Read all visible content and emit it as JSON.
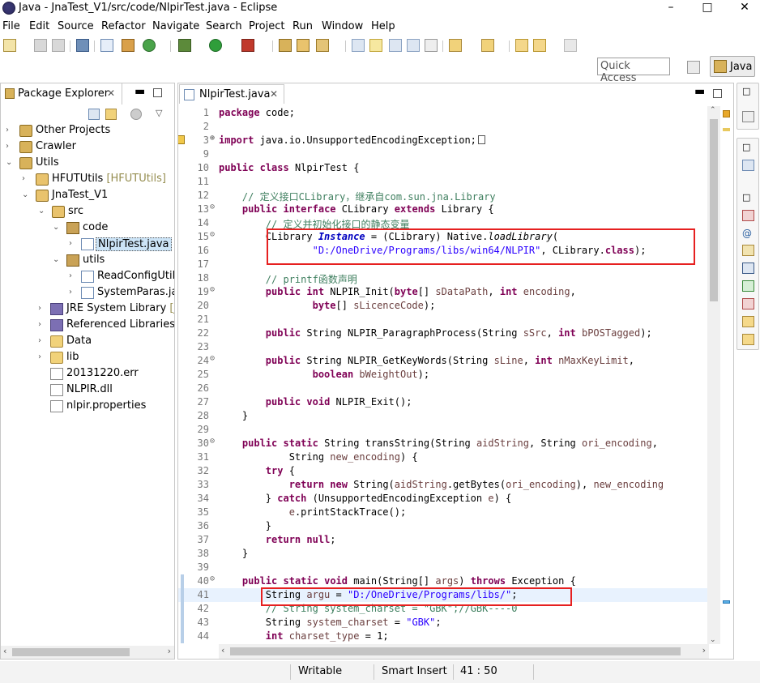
{
  "window": {
    "title": "Java - JnaTest_V1/src/code/NlpirTest.java - Eclipse"
  },
  "menu": [
    "File",
    "Edit",
    "Source",
    "Refactor",
    "Navigate",
    "Search",
    "Project",
    "Run",
    "Window",
    "Help"
  ],
  "quick_access": {
    "placeholder": "Quick Access"
  },
  "perspective": {
    "label": "Java"
  },
  "package_explorer": {
    "tab_label": "Package Explorer",
    "tree": [
      {
        "label": "Other Projects",
        "decoration": ""
      },
      {
        "label": "Crawler",
        "decoration": ""
      },
      {
        "label": "Utils",
        "decoration": ""
      },
      {
        "label": "HFUTUtils",
        "decoration": " [HFUTUtils]"
      },
      {
        "label": "JnaTest_V1",
        "decoration": ""
      },
      {
        "label": "src",
        "decoration": ""
      },
      {
        "label": "code",
        "decoration": ""
      },
      {
        "label": "NlpirTest.java",
        "decoration": ""
      },
      {
        "label": "utils",
        "decoration": ""
      },
      {
        "label": "ReadConfigUtil.j",
        "decoration": ""
      },
      {
        "label": "SystemParas.jav",
        "decoration": ""
      },
      {
        "label": "JRE System Library",
        "decoration": " [Ja"
      },
      {
        "label": "Referenced Libraries",
        "decoration": ""
      },
      {
        "label": "Data",
        "decoration": ""
      },
      {
        "label": "lib",
        "decoration": ""
      },
      {
        "label": "20131220.err",
        "decoration": ""
      },
      {
        "label": "NLPIR.dll",
        "decoration": ""
      },
      {
        "label": "nlpir.properties",
        "decoration": ""
      }
    ]
  },
  "editor": {
    "tab_label": "NlpirTest.java",
    "line_numbers": [
      "1",
      "2",
      "3",
      "9",
      "10",
      "11",
      "12",
      "13",
      "14",
      "15",
      "16",
      "17",
      "18",
      "19",
      "20",
      "21",
      "22",
      "23",
      "24",
      "25",
      "26",
      "27",
      "28",
      "29",
      "30",
      "31",
      "32",
      "33",
      "34",
      "35",
      "36",
      "37",
      "38",
      "39",
      "40",
      "41",
      "42",
      "43",
      "44"
    ],
    "lines": [
      "package code;",
      "",
      "import java.io.UnsupportedEncodingException;",
      "",
      "public class NlpirTest {",
      "",
      "    // 定义接口CLibrary，继承自com.sun.jna.Library",
      "    public interface CLibrary extends Library {",
      "        // 定义并初始化接口的静态变量",
      "        CLibrary Instance = (CLibrary) Native.loadLibrary(",
      "                \"D:/OneDrive/Programs/libs/win64/NLPIR\", CLibrary.class);",
      "",
      "        // printf函数声明",
      "        public int NLPIR_Init(byte[] sDataPath, int encoding,",
      "                byte[] sLicenceCode);",
      "",
      "        public String NLPIR_ParagraphProcess(String sSrc, int bPOSTagged);",
      "",
      "        public String NLPIR_GetKeyWords(String sLine, int nMaxKeyLimit,",
      "                boolean bWeightOut);",
      "",
      "        public void NLPIR_Exit();",
      "    }",
      "",
      "    public static String transString(String aidString, String ori_encoding,",
      "            String new_encoding) {",
      "        try {",
      "            return new String(aidString.getBytes(ori_encoding), new_encoding",
      "        } catch (UnsupportedEncodingException e) {",
      "            e.printStackTrace();",
      "        }",
      "        return null;",
      "    }",
      "",
      "    public static void main(String[] args) throws Exception {",
      "        String argu = \"D:/OneDrive/Programs/libs/\";",
      "        // String system_charset = \"GBK\";//GBK----0",
      "        String system_charset = \"GBK\";",
      "        int charset_type = 1;"
    ]
  },
  "status": {
    "writable": "Writable",
    "insert_mode": "Smart Insert",
    "position": "41 : 50"
  }
}
